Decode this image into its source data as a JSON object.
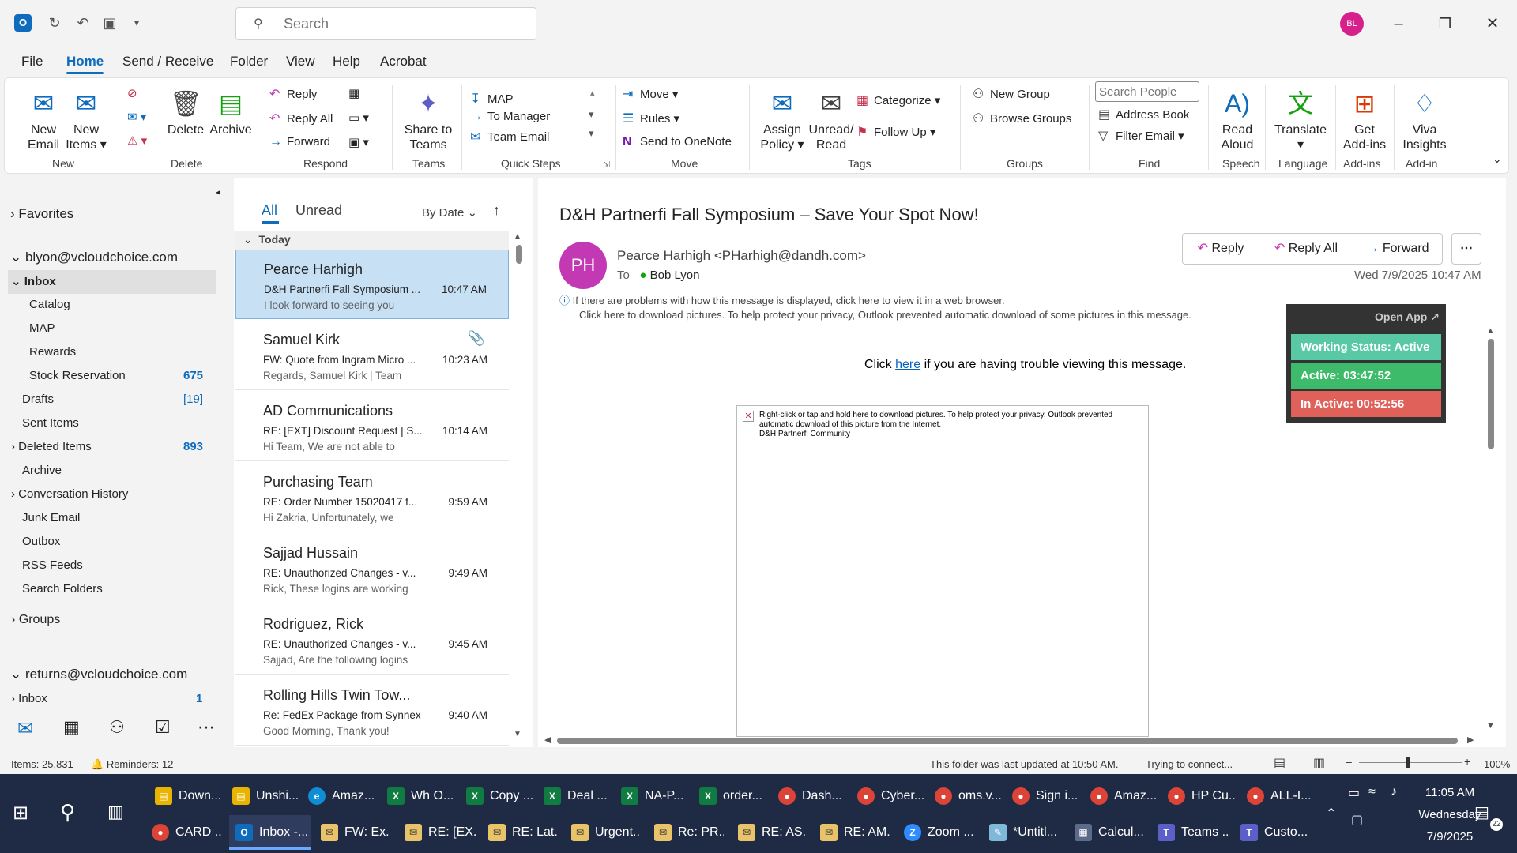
{
  "titlebar": {
    "search_placeholder": "Search",
    "user_initials": "BL"
  },
  "menu": {
    "tabs": [
      "File",
      "Home",
      "Send / Receive",
      "Folder",
      "View",
      "Help",
      "Acrobat"
    ]
  },
  "ribbon": {
    "new_email": "New\nEmail",
    "new_email_l1": "New",
    "new_email_l2": "Email",
    "new_items_l1": "New",
    "new_items_l2": "Items",
    "delete": "Delete",
    "archive": "Archive",
    "reply": "Reply",
    "reply_all": "Reply All",
    "forward": "Forward",
    "share_teams_l1": "Share to",
    "share_teams_l2": "Teams",
    "qs_map": "MAP",
    "qs_to_manager": "To Manager",
    "qs_team_email": "Team Email",
    "move": "Move",
    "rules": "Rules",
    "send_onenote": "Send to OneNote",
    "assign_policy_l1": "Assign",
    "assign_policy_l2": "Policy",
    "unread_read_l1": "Unread/",
    "unread_read_l2": "Read",
    "categorize": "Categorize",
    "follow_up": "Follow Up",
    "new_group": "New Group",
    "browse_groups": "Browse Groups",
    "search_people": "Search People",
    "address_book": "Address Book",
    "filter_email": "Filter Email",
    "read_aloud_l1": "Read",
    "read_aloud_l2": "Aloud",
    "translate": "Translate",
    "get_addins_l1": "Get",
    "get_addins_l2": "Add-ins",
    "viva_l1": "Viva",
    "viva_l2": "Insights",
    "groups": [
      "New",
      "Delete",
      "Respond",
      "Teams",
      "Quick Steps",
      "Move",
      "Tags",
      "Groups",
      "Find",
      "Speech",
      "Language",
      "Add-ins",
      "Add-in"
    ]
  },
  "nav": {
    "favorites": "Favorites",
    "account1": "blyon@vcloudchoice.com",
    "inbox": "Inbox",
    "catalog": "Catalog",
    "map": "MAP",
    "rewards": "Rewards",
    "stock_reservation": "Stock Reservation",
    "stock_count": "675",
    "drafts": "Drafts",
    "drafts_count": "[19]",
    "sent": "Sent Items",
    "deleted": "Deleted Items",
    "deleted_count": "893",
    "archive": "Archive",
    "conv_history": "Conversation History",
    "junk": "Junk Email",
    "outbox": "Outbox",
    "rss": "RSS Feeds",
    "search_folders": "Search Folders",
    "groups": "Groups",
    "account2": "returns@vcloudchoice.com",
    "inbox2": "Inbox",
    "inbox2_count": "1"
  },
  "list": {
    "tab_all": "All",
    "tab_unread": "Unread",
    "sort": "By Date",
    "section": "Today",
    "messages": [
      {
        "from": "Pearce Harhigh",
        "subject": "D&H Partnerfi Fall Symposium ...",
        "time": "10:47 AM",
        "preview": "I look forward to seeing you"
      },
      {
        "from": "Samuel  Kirk",
        "subject": "FW: Quote from Ingram Micro ...",
        "time": "10:23 AM",
        "preview": "Regards,  Samuel Kirk | Team"
      },
      {
        "from": "AD Communications",
        "subject": "RE: [EXT] Discount Request | S...",
        "time": "10:14 AM",
        "preview": "Hi Team,  We are not able to"
      },
      {
        "from": "Purchasing Team",
        "subject": "RE: Order Number 15020417 f...",
        "time": "9:59 AM",
        "preview": "Hi Zakria,  Unfortunately, we"
      },
      {
        "from": "Sajjad Hussain",
        "subject": "RE: Unauthorized Changes - v...",
        "time": "9:49 AM",
        "preview": "Rick,  These logins are working"
      },
      {
        "from": "Rodriguez, Rick",
        "subject": "RE: Unauthorized Changes - v...",
        "time": "9:45 AM",
        "preview": "Sajjad,  Are the following logins"
      },
      {
        "from": "Rolling Hills Twin Tow...",
        "subject": "Re: FedEx Package from Synnex",
        "time": "9:40 AM",
        "preview": "Good Morning,  Thank you!"
      }
    ]
  },
  "reading": {
    "subject": "D&H Partnerfi Fall Symposium – Save Your Spot Now!",
    "initials": "PH",
    "sender": "Pearce Harhigh <PHarhigh@dandh.com>",
    "to_label": "To",
    "to_name": "Bob Lyon",
    "date": "Wed 7/9/2025 10:47 AM",
    "reply": "Reply",
    "reply_all": "Reply All",
    "forward": "Forward",
    "info1": "If there are problems with how this message is displayed, click here to view it in a web browser.",
    "info2": "Click here to download pictures. To help protect your privacy, Outlook prevented automatic download of some pictures in this message.",
    "click_pre": "Click ",
    "click_link": "here",
    "click_post": " if you are having trouble viewing this message.",
    "img_msg1": "Right-click or tap and hold here to download pictures. To help protect your privacy, Outlook prevented",
    "img_msg2": "automatic download of this picture from the Internet.",
    "img_msg3": "D&H Partnerfi Community",
    "widget_open": "Open App",
    "widget_status": "Working Status: Active",
    "widget_active": "Active: 03:47:52",
    "widget_inactive": "In Active: 00:52:56"
  },
  "status": {
    "items": "Items: 25,831",
    "reminders": "Reminders: 12",
    "updated": "This folder was last updated at 10:50 AM.",
    "connecting": "Trying to connect...",
    "zoom": "100%"
  },
  "taskbar": {
    "row1": [
      "Down...",
      "Unshi...",
      "Amaz...",
      "Wh O...",
      "Copy ...",
      "Deal ...",
      "NA-P...",
      "order...",
      "Dash...",
      "Cyber...",
      "oms.v...",
      "Sign i...",
      "Amaz...",
      "HP Cu...",
      "ALL-I..."
    ],
    "row2": [
      "CARD ...",
      "Inbox -...",
      "FW: Ex...",
      "RE: [EX...",
      "RE: Lat...",
      "Urgent...",
      "Re: PR...",
      "RE: AS...",
      "RE: AM...",
      "Zoom ...",
      "*Untitl...",
      "Calcul...",
      "Teams ...",
      "Custo..."
    ],
    "time": "11:05 AM",
    "day": "Wednesday",
    "date": "7/9/2025",
    "notif_count": "22"
  },
  "colors": {
    "accent": "#0f6cbd",
    "status_active": "#59c9a5",
    "active_green": "#3dbb6a",
    "inactive_red": "#e0605a"
  }
}
